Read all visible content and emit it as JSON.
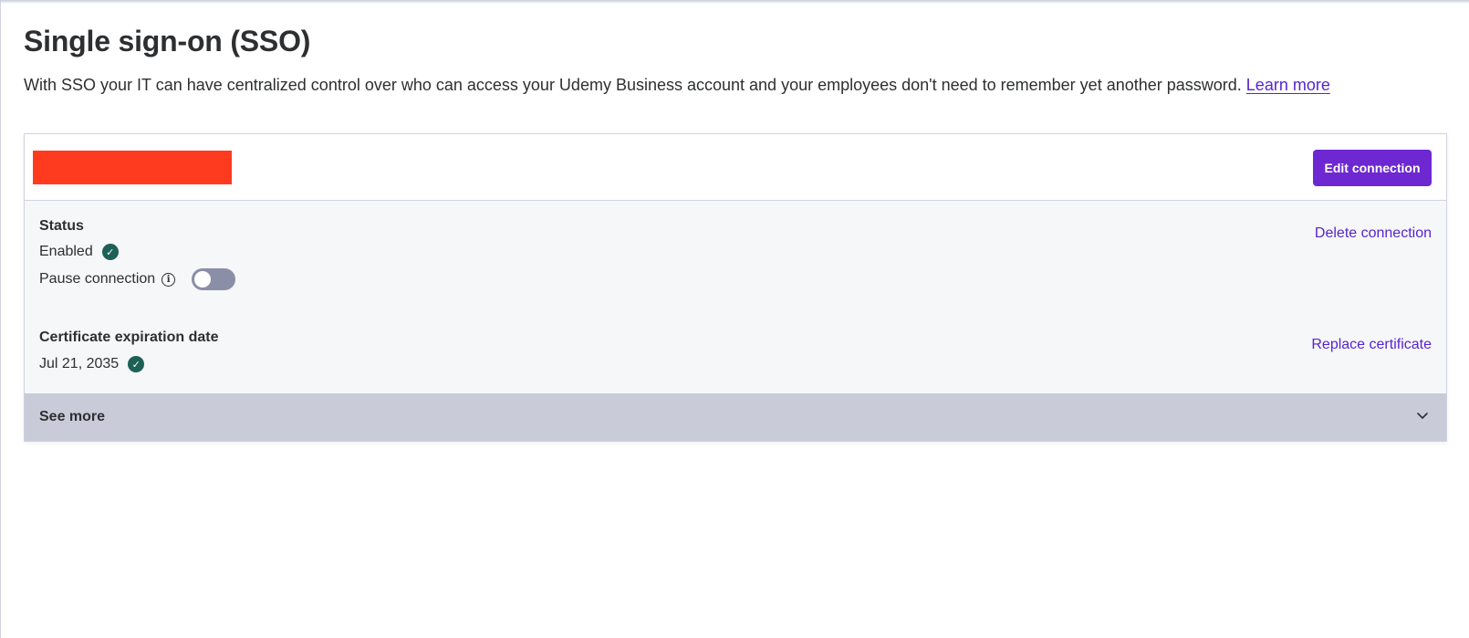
{
  "page": {
    "title": "Single sign-on (SSO)",
    "description": "With SSO your IT can have centralized control over who can access your Udemy Business account and your employees don't need to remember yet another password.",
    "learn_more_label": "Learn more"
  },
  "connection_card": {
    "name_redacted": true,
    "edit_button_label": "Edit connection",
    "status": {
      "heading": "Status",
      "value": "Enabled",
      "status_icon": "check-circle-icon",
      "pause_label": "Pause connection",
      "pause_info_icon": "info-icon",
      "pause_toggle_on": false,
      "delete_label": "Delete connection"
    },
    "certificate": {
      "heading": "Certificate expiration date",
      "value": "Jul 21, 2035",
      "status_icon": "check-circle-icon",
      "replace_label": "Replace certificate"
    },
    "see_more_label": "See more",
    "see_more_icon": "chevron-down-icon"
  },
  "colors": {
    "primary": "#6d28d2",
    "link": "#5624d0",
    "success": "#1e6055",
    "redaction": "#ff3b1f",
    "toggle_off": "#8b8ea7",
    "see_more_bg": "#cacbd9"
  }
}
